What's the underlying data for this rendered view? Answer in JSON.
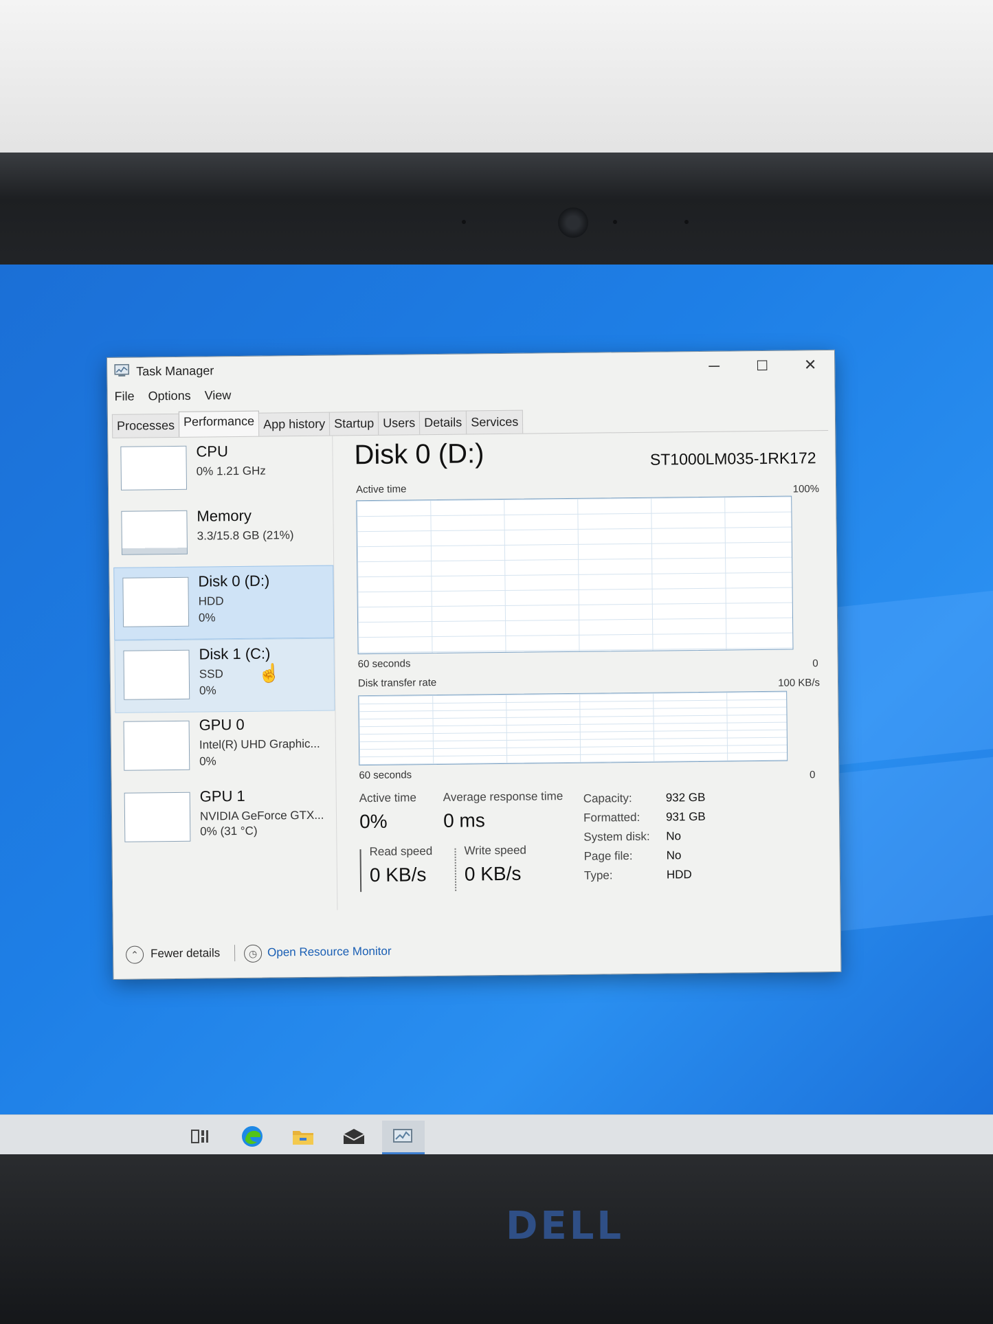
{
  "window": {
    "title": "Task Manager",
    "controls": {
      "minimize": "─",
      "maximize": "☐",
      "close": "✕"
    }
  },
  "menu": [
    "File",
    "Options",
    "View"
  ],
  "tabs": [
    {
      "label": "Processes"
    },
    {
      "label": "Performance",
      "active": true
    },
    {
      "label": "App history"
    },
    {
      "label": "Startup"
    },
    {
      "label": "Users"
    },
    {
      "label": "Details"
    },
    {
      "label": "Services"
    }
  ],
  "sidebar": [
    {
      "name": "CPU",
      "line1": "0% 1.21 GHz",
      "line2": ""
    },
    {
      "name": "Memory",
      "line1": "3.3/15.8 GB (21%)",
      "line2": ""
    },
    {
      "name": "Disk 0 (D:)",
      "line1": "HDD",
      "line2": "0%",
      "selected": true
    },
    {
      "name": "Disk 1 (C:)",
      "line1": "SSD",
      "line2": "0%"
    },
    {
      "name": "GPU 0",
      "line1": "Intel(R) UHD Graphic...",
      "line2": "0%"
    },
    {
      "name": "GPU 1",
      "line1": "NVIDIA GeForce GTX...",
      "line2": "0% (31 °C)"
    }
  ],
  "main": {
    "title": "Disk 0 (D:)",
    "model": "ST1000LM035-1RK172",
    "graph1": {
      "label": "Active time",
      "max": "100%",
      "time": "60 seconds",
      "min": "0"
    },
    "graph2": {
      "label": "Disk transfer rate",
      "max": "100 KB/s",
      "time": "60 seconds",
      "min": "0"
    },
    "stats": {
      "active_time_label": "Active time",
      "active_time": "0%",
      "avg_response_label": "Average response time",
      "avg_response": "0 ms",
      "read_label": "Read speed",
      "read": "0 KB/s",
      "write_label": "Write speed",
      "write": "0 KB/s"
    },
    "details": [
      {
        "key": "Capacity:",
        "value": "932 GB"
      },
      {
        "key": "Formatted:",
        "value": "931 GB"
      },
      {
        "key": "System disk:",
        "value": "No"
      },
      {
        "key": "Page file:",
        "value": "No"
      },
      {
        "key": "Type:",
        "value": "HDD"
      }
    ]
  },
  "footer": {
    "fewer_details": "Fewer details",
    "resource_monitor": "Open Resource Monitor"
  },
  "brand": "DELL",
  "colors": {
    "desktop": "#1e7fe6",
    "selected": "#cfe3f6",
    "link": "#1a5fb4"
  }
}
